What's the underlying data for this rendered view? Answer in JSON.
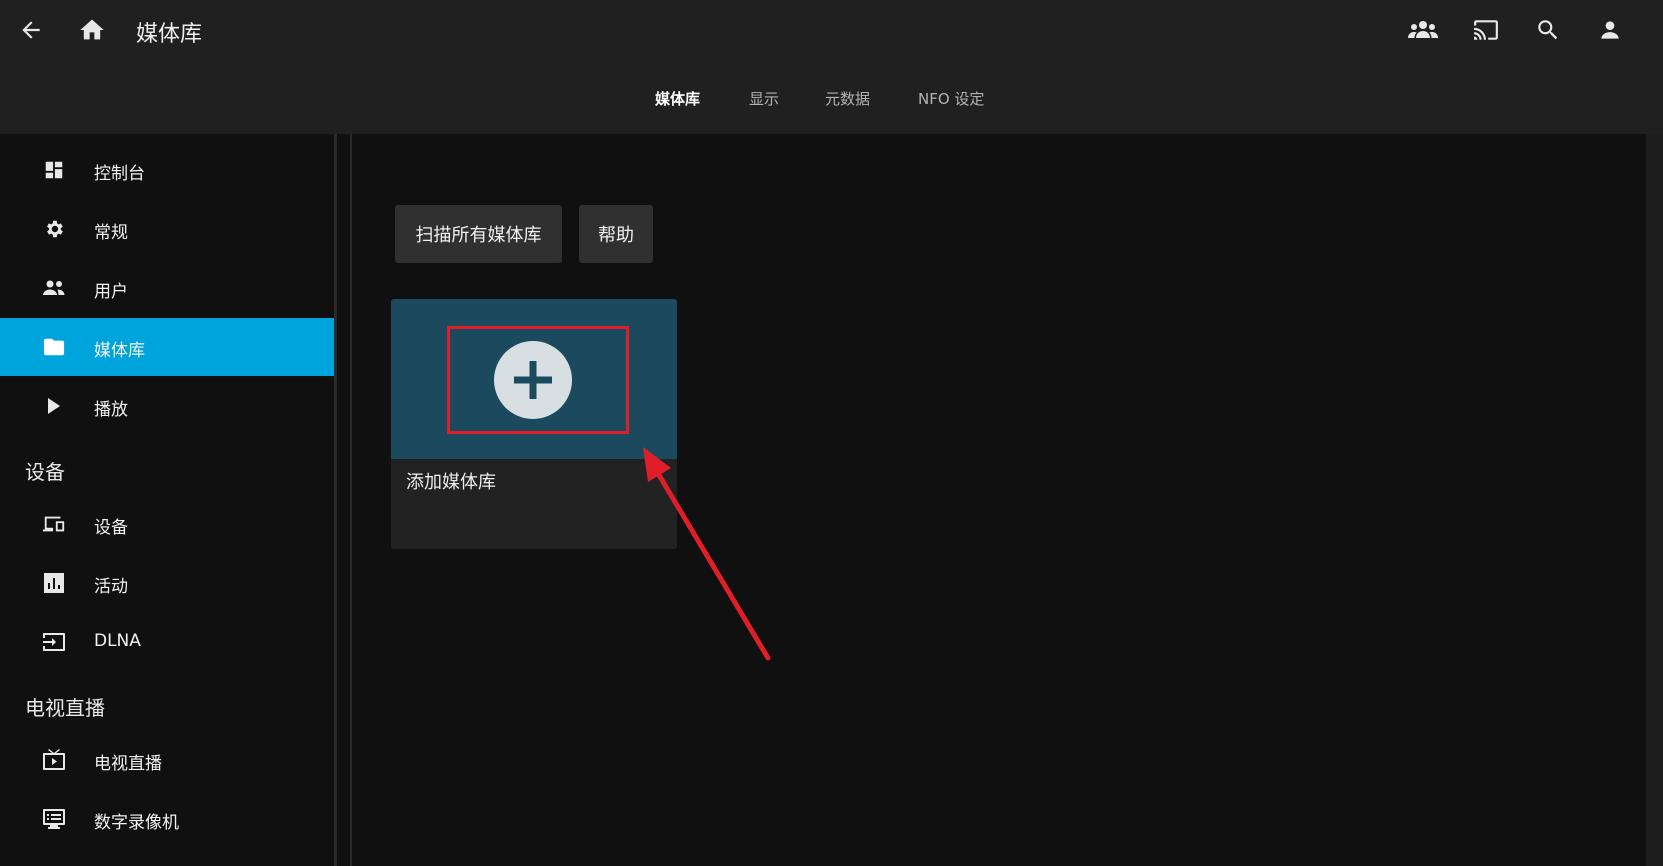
{
  "header": {
    "title": "媒体库",
    "icons": [
      "back-arrow-icon",
      "home-icon",
      "users-icon",
      "cast-icon",
      "search-icon",
      "account-icon"
    ]
  },
  "tabs": [
    {
      "label": "媒体库",
      "active": true
    },
    {
      "label": "显示",
      "active": false
    },
    {
      "label": "元数据",
      "active": false
    },
    {
      "label": "NFO 设定",
      "active": false
    }
  ],
  "sidebar": {
    "items": [
      {
        "label": "控制台",
        "icon": "dashboard-icon"
      },
      {
        "label": "常规",
        "icon": "gear-icon"
      },
      {
        "label": "用户",
        "icon": "people-icon"
      },
      {
        "label": "媒体库",
        "icon": "folder-icon",
        "selected": true
      },
      {
        "label": "播放",
        "icon": "play-icon"
      }
    ],
    "section_devices": "设备",
    "device_items": [
      {
        "label": "设备",
        "icon": "devices-icon"
      },
      {
        "label": "活动",
        "icon": "activity-chart-icon"
      },
      {
        "label": "DLNA",
        "icon": "dlna-input-icon"
      }
    ],
    "section_livetv": "电视直播",
    "livetv_items": [
      {
        "label": "电视直播",
        "icon": "live-tv-icon"
      },
      {
        "label": "数字录像机",
        "icon": "dvr-icon"
      }
    ]
  },
  "main": {
    "scan_button": "扫描所有媒体库",
    "help_button": "帮助",
    "add_card_label": "添加媒体库"
  },
  "colors": {
    "accent": "#00a4dc",
    "card_top": "#1b4a5e",
    "annotation_red": "#e01e2a"
  }
}
